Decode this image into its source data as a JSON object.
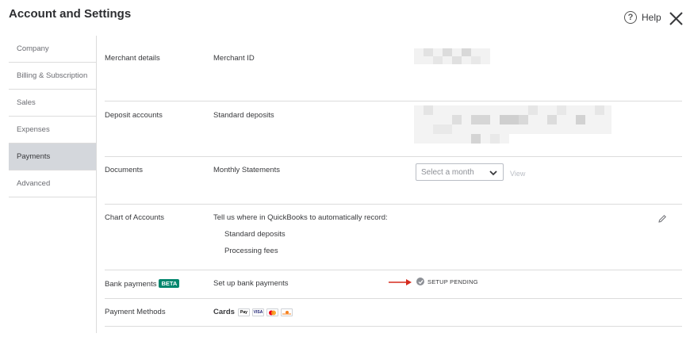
{
  "header": {
    "title": "Account and Settings",
    "help_label": "Help"
  },
  "sidebar": {
    "items": [
      {
        "label": "Company"
      },
      {
        "label": "Billing & Subscription"
      },
      {
        "label": "Sales"
      },
      {
        "label": "Expenses"
      },
      {
        "label": "Payments",
        "active": true
      },
      {
        "label": "Advanced"
      }
    ]
  },
  "rows": {
    "merchant": {
      "section": "Merchant details",
      "label": "Merchant ID"
    },
    "deposit": {
      "section": "Deposit accounts",
      "label": "Standard deposits"
    },
    "documents": {
      "section": "Documents",
      "label": "Monthly Statements",
      "select_placeholder": "Select a month",
      "view_label": "View"
    },
    "chart": {
      "section": "Chart of Accounts",
      "label": "Tell us where in QuickBooks to automatically record:",
      "sub1": "Standard deposits",
      "sub2": "Processing fees"
    },
    "bank": {
      "section": "Bank payments",
      "badge": "BETA",
      "label": "Set up bank payments",
      "status": "SETUP PENDING"
    },
    "methods": {
      "section": "Payment Methods",
      "label": "Cards",
      "cards": [
        "apple-pay",
        "visa",
        "mastercard",
        "discover"
      ]
    }
  },
  "colors": {
    "active_sidebar": "#d4d7dc",
    "beta_badge": "#00866d",
    "arrow": "#d52b1e"
  },
  "icons": [
    "help-icon",
    "close-icon",
    "chevron-down-icon",
    "pencil-icon",
    "arrow-right-icon",
    "check-circle-icon"
  ]
}
